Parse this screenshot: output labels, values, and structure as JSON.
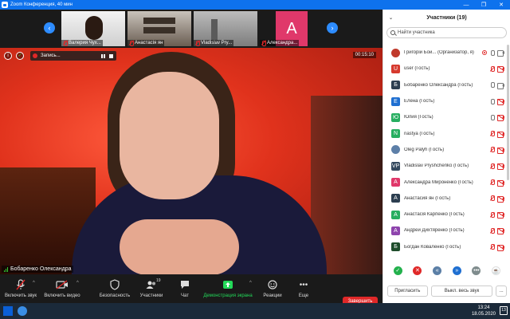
{
  "window": {
    "title": "Zoom Конференция, 40 мин",
    "minimize": "—",
    "maximize": "❐",
    "close": "✕"
  },
  "filmstrip": {
    "prev": "‹",
    "next": "›",
    "thumbs": [
      {
        "name": "Валерия Чух..."
      },
      {
        "name": "Анастасія ян"
      },
      {
        "name": "Vladislav Pry..."
      },
      {
        "name": "Александра...",
        "avatar": "A"
      }
    ]
  },
  "video": {
    "recording_label": "Запись...",
    "timer": "00:15:10",
    "speaker_name": "Бобаренко Олександра"
  },
  "toolbar": {
    "items": [
      {
        "label": "Включить звук",
        "icon": "mic-muted-icon"
      },
      {
        "label": "Включить видео",
        "icon": "video-off-icon"
      },
      {
        "label": "Безопасность",
        "icon": "shield-icon"
      },
      {
        "label": "Участники",
        "icon": "participants-icon",
        "count": "19"
      },
      {
        "label": "Чат",
        "icon": "chat-icon"
      },
      {
        "label": "Демонстрация экрана",
        "icon": "share-screen-icon"
      },
      {
        "label": "Реакции",
        "icon": "reactions-icon"
      },
      {
        "label": "Еще",
        "icon": "more-icon"
      }
    ],
    "end_label": "Завершить"
  },
  "panel": {
    "title": "Участники (19)",
    "search_placeholder": "Найти участника",
    "participants": [
      {
        "name": "Григорій Бой... (Организатор, я)",
        "avatar": "",
        "color": "#c0392b",
        "mic": "on",
        "cam": "on",
        "rec": true
      },
      {
        "name": "user (Гость)",
        "avatar": "U",
        "color": "#d63a2e",
        "mic": "off",
        "cam": "off"
      },
      {
        "name": "Бобаренко Олександра (Гость)",
        "avatar": "Б",
        "color": "#2c3e50",
        "mic": "on",
        "cam": "on"
      },
      {
        "name": "Елена (Гость)",
        "avatar": "E",
        "color": "#1f6fd1",
        "mic": "on",
        "cam": "off"
      },
      {
        "name": "Юлия (Гость)",
        "avatar": "Ю",
        "color": "#27ae60",
        "mic": "on",
        "cam": "off"
      },
      {
        "name": "nastya (Гость)",
        "avatar": "N",
        "color": "#27ae60",
        "mic": "off",
        "cam": "off"
      },
      {
        "name": "Oleg Palyh (Гость)",
        "avatar": "",
        "color": "#5d7fa8",
        "mic": "off",
        "cam": "off"
      },
      {
        "name": "Vladislav Pryshchenko (Гость)",
        "avatar": "VP",
        "color": "#34495e",
        "mic": "off",
        "cam": "off"
      },
      {
        "name": "Александра Мироненко (Гость)",
        "avatar": "A",
        "color": "#e0386a",
        "mic": "off",
        "cam": "off"
      },
      {
        "name": "Анастасия ян (Гость)",
        "avatar": "A",
        "color": "#2c3e50",
        "mic": "off",
        "cam": "off"
      },
      {
        "name": "Анастасія Карпенко (Гость)",
        "avatar": "A",
        "color": "#27ae60",
        "mic": "off",
        "cam": "off"
      },
      {
        "name": "Андрей Дихтяренко (Гость)",
        "avatar": "A",
        "color": "#8e44ad",
        "mic": "off",
        "cam": "off"
      },
      {
        "name": "Богдан Коваленко (Гость)",
        "avatar": "Б",
        "color": "#1e4d2b",
        "mic": "off",
        "cam": "off"
      }
    ],
    "reactions": [
      {
        "symbol": "✓",
        "color": "#23b14d"
      },
      {
        "symbol": "✕",
        "color": "#e02828"
      },
      {
        "symbol": "«",
        "color": "#5b7fa6"
      },
      {
        "symbol": "»",
        "color": "#1f6fd1"
      },
      {
        "symbol": "•••",
        "color": "#7f8c8d"
      },
      {
        "symbol": "☕",
        "color": "#ffffff"
      }
    ],
    "invite": "Пригласить",
    "mute_all": "Выкл. весь звук",
    "more": "..."
  },
  "taskbar": {
    "time": "13:24",
    "date": "18.05.2020",
    "notifications": "13"
  }
}
